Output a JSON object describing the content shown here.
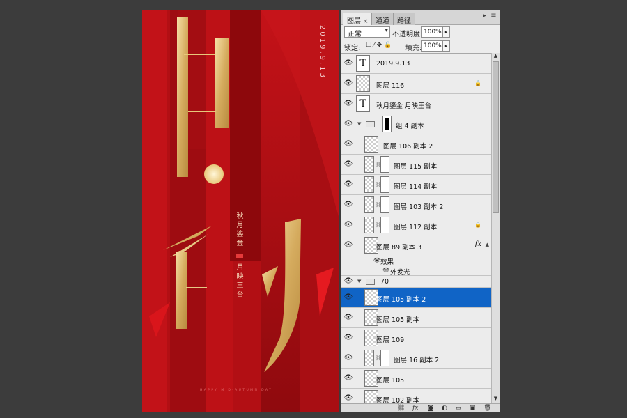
{
  "poster": {
    "date": "2019.9.13",
    "title_line1": "秋月鎏金",
    "title_line2": "月映王台",
    "footer": "HAPPY MID-AUTUMN DAY"
  },
  "panel": {
    "tabs": [
      "图层",
      "通道",
      "路径"
    ],
    "close_glyph": "×",
    "blend_mode": "正常",
    "opacity_label": "不透明度:",
    "opacity_value": "100%",
    "lock_label": "锁定:",
    "fill_label": "填充:",
    "fill_value": "100%"
  },
  "layers": [
    {
      "name": "2019.9.13",
      "kind": "text"
    },
    {
      "name": "图层 116",
      "kind": "raster",
      "locked": true
    },
    {
      "name": "秋月鎏金  月映王台",
      "kind": "text"
    },
    {
      "name": "组 4 副本",
      "kind": "group"
    },
    {
      "name": "图层 106 副本 2",
      "kind": "raster"
    },
    {
      "name": "图层 115 副本",
      "kind": "masked"
    },
    {
      "name": "图层 114 副本",
      "kind": "masked"
    },
    {
      "name": "图层 103 副本 2",
      "kind": "masked"
    },
    {
      "name": "图层 112 副本",
      "kind": "masked",
      "locked": true
    },
    {
      "name": "图层 89 副本 3",
      "kind": "raster",
      "fx": true
    },
    {
      "name": "效果",
      "kind": "effect-header"
    },
    {
      "name": "外发光",
      "kind": "effect"
    },
    {
      "name": "70",
      "kind": "group"
    },
    {
      "name": "图层 105 副本 2",
      "kind": "raster",
      "selected": true
    },
    {
      "name": "图层 105 副本",
      "kind": "raster"
    },
    {
      "name": "图层 109",
      "kind": "raster"
    },
    {
      "name": "图层 16 副本 2",
      "kind": "masked"
    },
    {
      "name": "图层 105",
      "kind": "raster"
    },
    {
      "name": "图层 102 副本",
      "kind": "raster"
    }
  ],
  "fx_symbol": "fx",
  "icons": {
    "eye": "eye-icon",
    "lock": "lock-icon",
    "chain": "link-icon",
    "folder": "folder-icon",
    "text_layer": "T"
  }
}
